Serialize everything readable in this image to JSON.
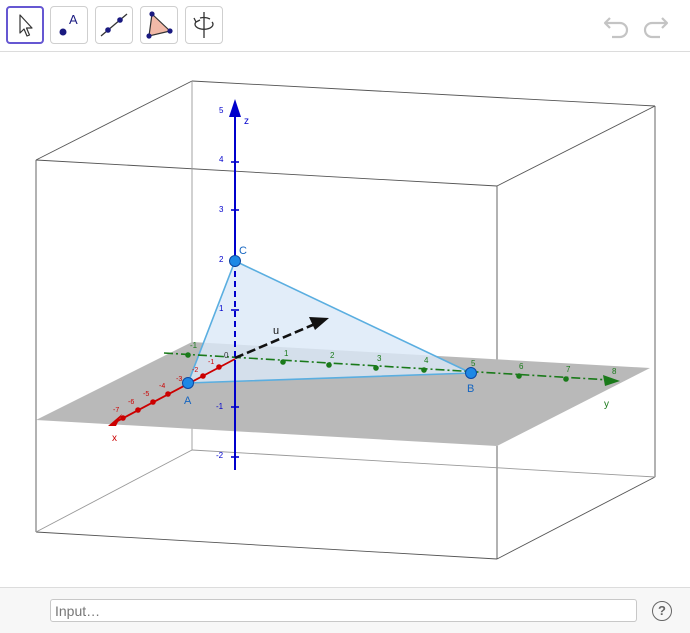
{
  "toolbar": {
    "tools": [
      {
        "name": "move-tool",
        "icon": "arrow-cursor-icon",
        "selected": true
      },
      {
        "name": "point-tool",
        "icon": "point-icon",
        "label": "A"
      },
      {
        "name": "line-tool",
        "icon": "line-through-two-points-icon"
      },
      {
        "name": "polygon-tool",
        "icon": "triangle-polygon-icon"
      },
      {
        "name": "rotate-view-tool",
        "icon": "rotate-3d-view-icon"
      }
    ],
    "undo_icon": "undo-icon",
    "redo_icon": "redo-icon",
    "point_tool_label": "A"
  },
  "graphics": {
    "axes": {
      "x": {
        "label": "x",
        "color": "#cc0000",
        "ticks": [
          "-7",
          "-6",
          "-5",
          "-4",
          "-3",
          "-2",
          "-1"
        ]
      },
      "y": {
        "label": "y",
        "color": "#1a7a1a",
        "ticks": [
          "-1",
          "1",
          "2",
          "3",
          "4",
          "5",
          "6",
          "7",
          "8"
        ]
      },
      "z": {
        "label": "z",
        "color": "#0000cc",
        "ticks": [
          "5",
          "4",
          "3",
          "2",
          "1",
          "-1",
          "-2"
        ]
      },
      "origin_label": "0"
    },
    "points": [
      {
        "label": "A",
        "color": "#1565c0"
      },
      {
        "label": "B",
        "color": "#1565c0"
      },
      {
        "label": "C",
        "color": "#1565c0"
      }
    ],
    "vector": {
      "label": "u",
      "color": "#111111"
    },
    "plane_color": "#b9b9b9",
    "triangle_fill": "#dbe9f7",
    "triangle_stroke": "#5aaee0"
  },
  "input_bar": {
    "placeholder": "Input…",
    "value": ""
  },
  "help_label": "?",
  "help_icon": "help-icon"
}
